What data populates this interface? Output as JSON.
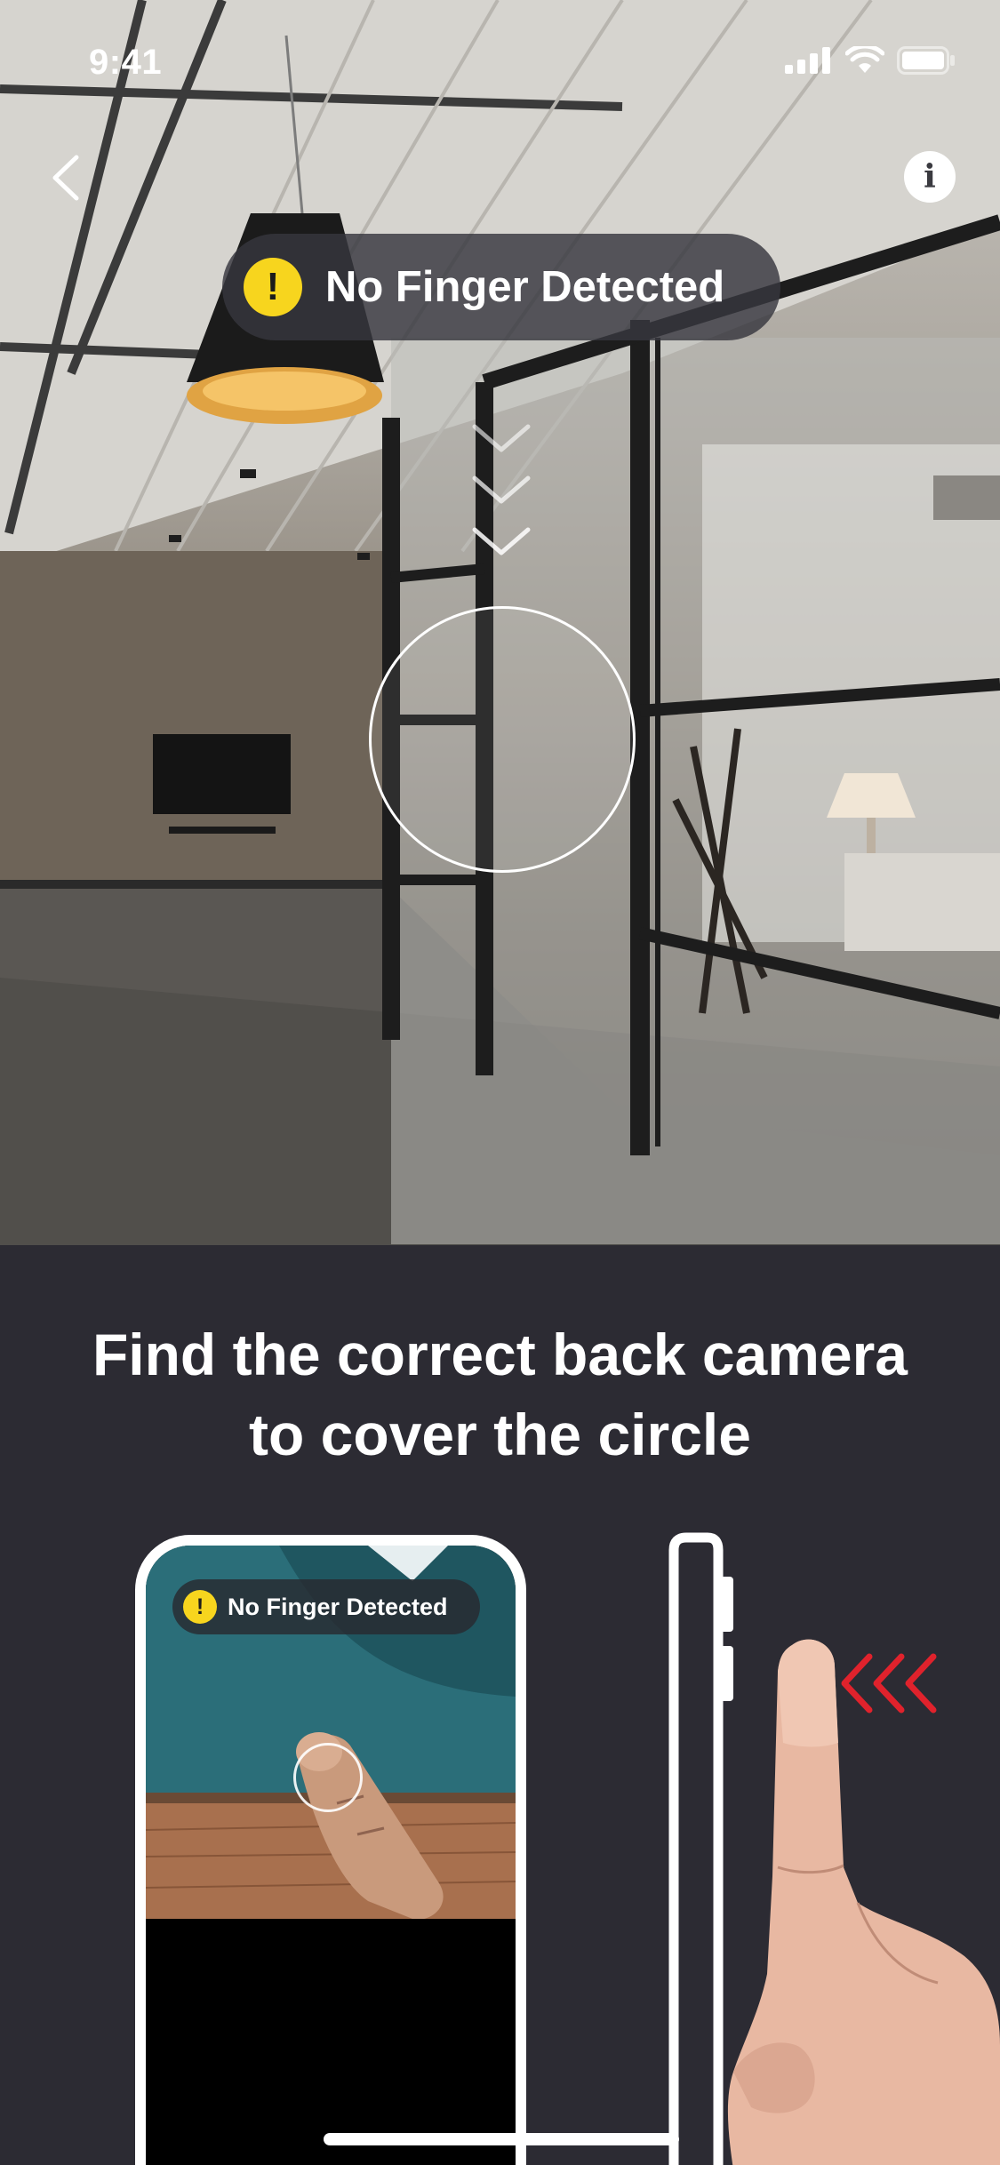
{
  "status_bar": {
    "time": "9:41",
    "icons": [
      "cellular-signal-icon",
      "wifi-icon",
      "battery-icon"
    ]
  },
  "nav": {
    "back_icon": "chevron-left-icon",
    "info_icon": "info-icon",
    "info_glyph": "i"
  },
  "toast": {
    "icon_glyph": "!",
    "text": "No Finger Detected",
    "icon_color": "#f7d51e"
  },
  "instruction": {
    "line1": "Find the correct back camera",
    "line2": "to cover the circle"
  },
  "illustration": {
    "mini_toast_icon_glyph": "!",
    "mini_toast_text": "No Finger Detected",
    "arrow_color": "#e0222c"
  },
  "colors": {
    "panel_background": "#2c2b33",
    "accent_yellow": "#f7d51e",
    "arrow_red": "#e0222c"
  }
}
